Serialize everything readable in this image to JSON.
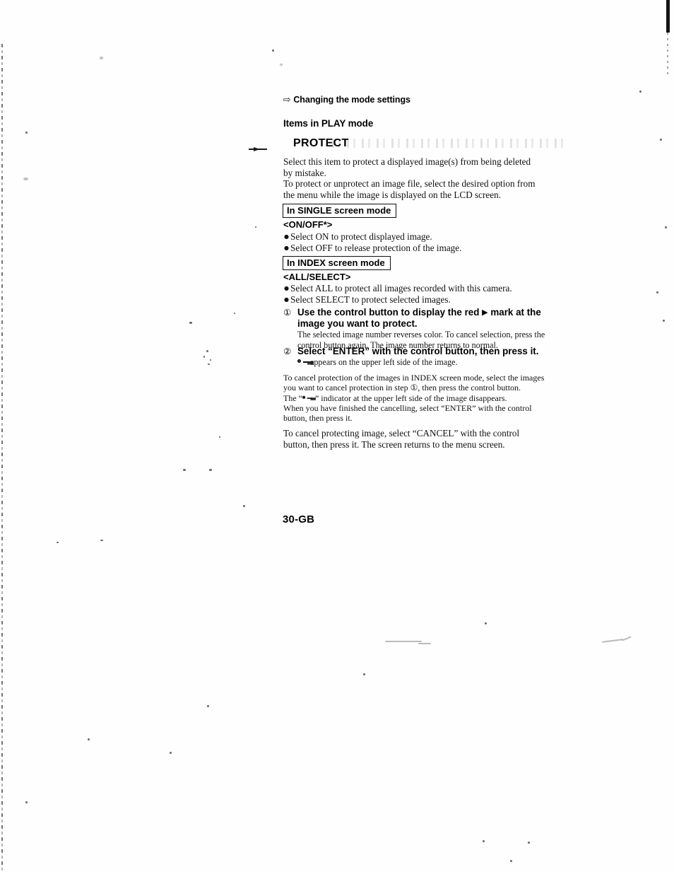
{
  "document": {
    "page_number": "30-GB",
    "section_heading": "Changing the mode settings",
    "section_heading_icon": "right-arrow-glyph",
    "subsection_heading": "Items in PLAY mode",
    "topic_title": "PROTECT"
  },
  "intro": {
    "line1": "Select this item to protect a displayed image(s) from being deleted",
    "line2": "by mistake.",
    "line3": "To protect or unprotect an image file, select the desired option from",
    "line4": "the menu while the image is displayed on the LCD screen."
  },
  "single_mode": {
    "box_label": "In SINGLE screen mode",
    "option_label": "<ON/OFF*>",
    "bullets": [
      "Select ON to protect displayed image.",
      "Select OFF to release protection of the image."
    ]
  },
  "index_mode": {
    "box_label": "In INDEX screen mode",
    "option_label": "<ALL/SELECT>",
    "bullets": [
      "Select ALL to protect all images recorded with this camera.",
      "Select SELECT to protect selected images."
    ],
    "steps": [
      {
        "number": "①",
        "bold_line1": "Use the control button to display the red",
        "bold_marker": "▶",
        "bold_line1_end": "mark at the",
        "bold_line2": "image you want to protect.",
        "sub_line1": "The selected image number reverses color. To cancel selection, press",
        "sub_line2": "the control button again. The image number returns to normal."
      },
      {
        "number": "②",
        "bold_line1": "Select “ENTER” with the control button, then press it.",
        "sub_icon": "key-icon",
        "sub_line1": "appears on the upper left side of the image."
      }
    ]
  },
  "cancel_index": {
    "line1": "To cancel protection of the images in INDEX screen mode, select the images",
    "line2a": "you want to cancel protection in step",
    "line2_step": "①",
    "line2b": ", then press the control button.",
    "line3a": "The “",
    "line3_icon": "key-icon",
    "line3b": "” indicator at the upper left side of the image disappears.",
    "line4": "When you have finished the cancelling, select “ENTER” with the control",
    "line5": "button, then press it."
  },
  "cancel_image": {
    "line1": "To cancel protecting image, select “CANCEL” with the control",
    "line2": "button, then press it. The screen returns to the menu screen."
  }
}
